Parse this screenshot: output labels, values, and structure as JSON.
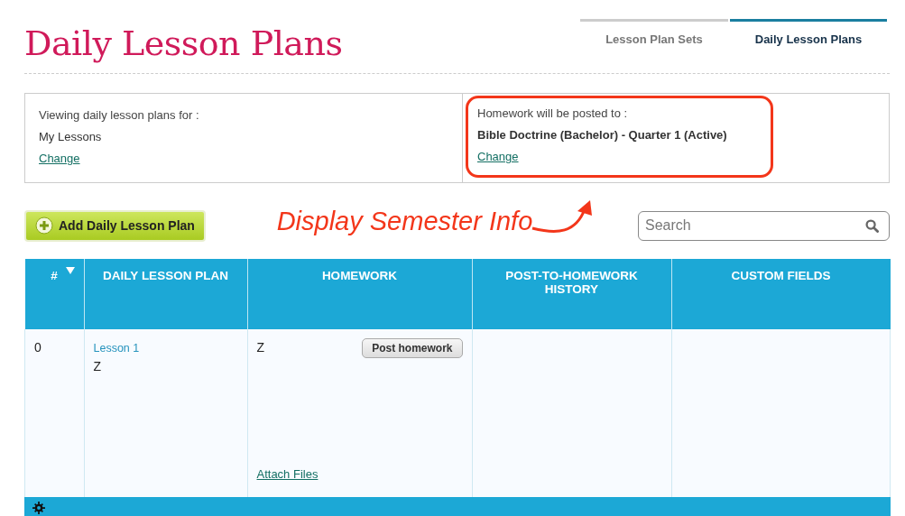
{
  "title": "Daily Lesson Plans",
  "tabs": [
    {
      "label": "Lesson Plan Sets",
      "selected": false
    },
    {
      "label": "Daily Lesson Plans",
      "selected": true
    }
  ],
  "info": [
    {
      "label": "Viewing daily lesson plans for :",
      "value": "My Lessons",
      "link": "Change",
      "highlighted": false
    },
    {
      "label": "Homework will be posted to :",
      "value": "Bible Doctrine (Bachelor) - Quarter 1 (Active)",
      "link": "Change",
      "highlighted": true
    }
  ],
  "annotation": {
    "text": "Display Semester Info"
  },
  "add_button": "Add Daily Lesson Plan",
  "search": {
    "placeholder": "Search"
  },
  "table": {
    "columns": [
      {
        "label": "#",
        "sorted": true
      },
      {
        "label": "DAILY LESSON PLAN",
        "sorted": false
      },
      {
        "label": "HOMEWORK",
        "sorted": false
      },
      {
        "label": "POST-TO-HOMEWORK HISTORY",
        "sorted": false
      },
      {
        "label": "CUSTOM FIELDS",
        "sorted": false
      }
    ],
    "rows": [
      {
        "number": "0",
        "lesson_link": "Lesson 1",
        "lesson_text": "Z",
        "homework_text": "Z",
        "post_button": "Post homework",
        "attach_link": "Attach Files"
      }
    ]
  }
}
